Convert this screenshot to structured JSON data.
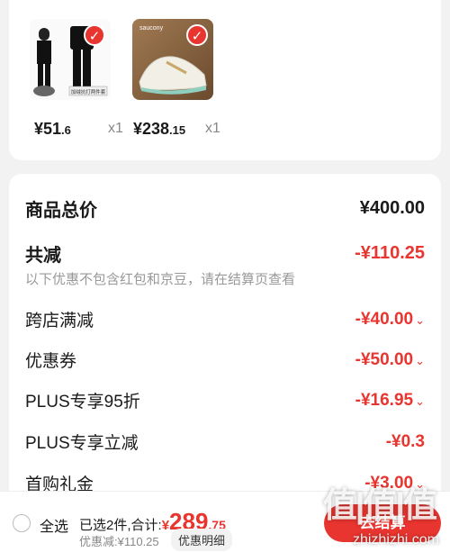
{
  "products": [
    {
      "price_int": "¥51",
      "price_dec": ".6",
      "qty": "x1",
      "image_caption": "加绒抗打两件套",
      "icon": "check-icon"
    },
    {
      "price_int": "¥238",
      "price_dec": ".15",
      "qty": "x1",
      "brand_text": "saucony",
      "icon": "check-icon"
    }
  ],
  "summary": {
    "total_label": "商品总价",
    "total_value": "¥400.00",
    "reduce_label": "共减",
    "reduce_value": "-¥110.25",
    "note": "以下优惠不包含红包和京豆，请在结算页查看",
    "items": [
      {
        "label": "跨店满减",
        "value": "-¥40.00",
        "caret": "⌄"
      },
      {
        "label": "优惠券",
        "value": "-¥50.00",
        "caret": "⌄"
      },
      {
        "label": "PLUS专享95折",
        "value": "-¥16.95",
        "caret": "⌄"
      },
      {
        "label": "PLUS专享立减",
        "value": "-¥0.3",
        "caret": ""
      },
      {
        "label": "首购礼金",
        "value": "-¥3.00",
        "caret": "⌄"
      }
    ]
  },
  "bottom": {
    "select_all": "全选",
    "selected_text": "已选2件,合计:",
    "total_cur": "¥",
    "total_int": "289",
    "total_dec": ".75",
    "discount_text": "优惠减:¥110.25",
    "detail_button": "优惠明细",
    "checkout_button": "去结算",
    "watermark_logo": "值|值|值",
    "watermark_url": "zhizhizhi.com"
  },
  "colors": {
    "accent": "#e8352f"
  }
}
